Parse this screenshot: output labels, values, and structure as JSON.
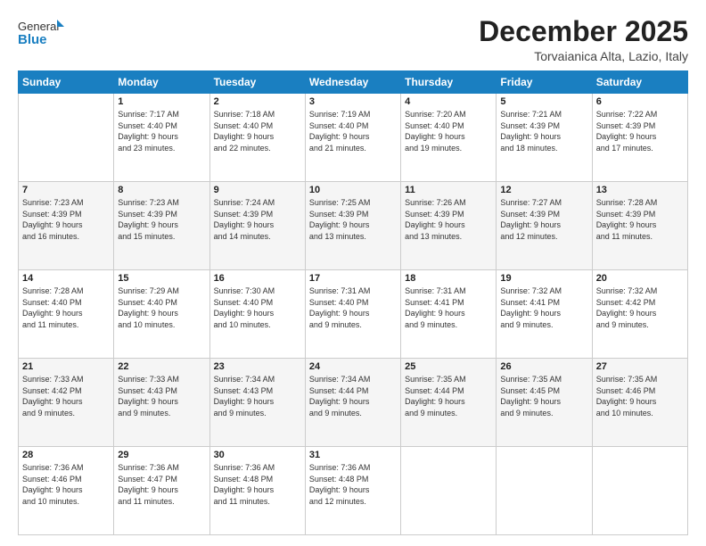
{
  "logo": {
    "general": "General",
    "blue": "Blue"
  },
  "header": {
    "title": "December 2025",
    "subtitle": "Torvaianica Alta, Lazio, Italy"
  },
  "weekdays": [
    "Sunday",
    "Monday",
    "Tuesday",
    "Wednesday",
    "Thursday",
    "Friday",
    "Saturday"
  ],
  "weeks": [
    [
      {
        "day": "",
        "info": ""
      },
      {
        "day": "1",
        "info": "Sunrise: 7:17 AM\nSunset: 4:40 PM\nDaylight: 9 hours\nand 23 minutes."
      },
      {
        "day": "2",
        "info": "Sunrise: 7:18 AM\nSunset: 4:40 PM\nDaylight: 9 hours\nand 22 minutes."
      },
      {
        "day": "3",
        "info": "Sunrise: 7:19 AM\nSunset: 4:40 PM\nDaylight: 9 hours\nand 21 minutes."
      },
      {
        "day": "4",
        "info": "Sunrise: 7:20 AM\nSunset: 4:40 PM\nDaylight: 9 hours\nand 19 minutes."
      },
      {
        "day": "5",
        "info": "Sunrise: 7:21 AM\nSunset: 4:39 PM\nDaylight: 9 hours\nand 18 minutes."
      },
      {
        "day": "6",
        "info": "Sunrise: 7:22 AM\nSunset: 4:39 PM\nDaylight: 9 hours\nand 17 minutes."
      }
    ],
    [
      {
        "day": "7",
        "info": "Sunrise: 7:23 AM\nSunset: 4:39 PM\nDaylight: 9 hours\nand 16 minutes."
      },
      {
        "day": "8",
        "info": "Sunrise: 7:23 AM\nSunset: 4:39 PM\nDaylight: 9 hours\nand 15 minutes."
      },
      {
        "day": "9",
        "info": "Sunrise: 7:24 AM\nSunset: 4:39 PM\nDaylight: 9 hours\nand 14 minutes."
      },
      {
        "day": "10",
        "info": "Sunrise: 7:25 AM\nSunset: 4:39 PM\nDaylight: 9 hours\nand 13 minutes."
      },
      {
        "day": "11",
        "info": "Sunrise: 7:26 AM\nSunset: 4:39 PM\nDaylight: 9 hours\nand 13 minutes."
      },
      {
        "day": "12",
        "info": "Sunrise: 7:27 AM\nSunset: 4:39 PM\nDaylight: 9 hours\nand 12 minutes."
      },
      {
        "day": "13",
        "info": "Sunrise: 7:28 AM\nSunset: 4:39 PM\nDaylight: 9 hours\nand 11 minutes."
      }
    ],
    [
      {
        "day": "14",
        "info": "Sunrise: 7:28 AM\nSunset: 4:40 PM\nDaylight: 9 hours\nand 11 minutes."
      },
      {
        "day": "15",
        "info": "Sunrise: 7:29 AM\nSunset: 4:40 PM\nDaylight: 9 hours\nand 10 minutes."
      },
      {
        "day": "16",
        "info": "Sunrise: 7:30 AM\nSunset: 4:40 PM\nDaylight: 9 hours\nand 10 minutes."
      },
      {
        "day": "17",
        "info": "Sunrise: 7:31 AM\nSunset: 4:40 PM\nDaylight: 9 hours\nand 9 minutes."
      },
      {
        "day": "18",
        "info": "Sunrise: 7:31 AM\nSunset: 4:41 PM\nDaylight: 9 hours\nand 9 minutes."
      },
      {
        "day": "19",
        "info": "Sunrise: 7:32 AM\nSunset: 4:41 PM\nDaylight: 9 hours\nand 9 minutes."
      },
      {
        "day": "20",
        "info": "Sunrise: 7:32 AM\nSunset: 4:42 PM\nDaylight: 9 hours\nand 9 minutes."
      }
    ],
    [
      {
        "day": "21",
        "info": "Sunrise: 7:33 AM\nSunset: 4:42 PM\nDaylight: 9 hours\nand 9 minutes."
      },
      {
        "day": "22",
        "info": "Sunrise: 7:33 AM\nSunset: 4:43 PM\nDaylight: 9 hours\nand 9 minutes."
      },
      {
        "day": "23",
        "info": "Sunrise: 7:34 AM\nSunset: 4:43 PM\nDaylight: 9 hours\nand 9 minutes."
      },
      {
        "day": "24",
        "info": "Sunrise: 7:34 AM\nSunset: 4:44 PM\nDaylight: 9 hours\nand 9 minutes."
      },
      {
        "day": "25",
        "info": "Sunrise: 7:35 AM\nSunset: 4:44 PM\nDaylight: 9 hours\nand 9 minutes."
      },
      {
        "day": "26",
        "info": "Sunrise: 7:35 AM\nSunset: 4:45 PM\nDaylight: 9 hours\nand 9 minutes."
      },
      {
        "day": "27",
        "info": "Sunrise: 7:35 AM\nSunset: 4:46 PM\nDaylight: 9 hours\nand 10 minutes."
      }
    ],
    [
      {
        "day": "28",
        "info": "Sunrise: 7:36 AM\nSunset: 4:46 PM\nDaylight: 9 hours\nand 10 minutes."
      },
      {
        "day": "29",
        "info": "Sunrise: 7:36 AM\nSunset: 4:47 PM\nDaylight: 9 hours\nand 11 minutes."
      },
      {
        "day": "30",
        "info": "Sunrise: 7:36 AM\nSunset: 4:48 PM\nDaylight: 9 hours\nand 11 minutes."
      },
      {
        "day": "31",
        "info": "Sunrise: 7:36 AM\nSunset: 4:48 PM\nDaylight: 9 hours\nand 12 minutes."
      },
      {
        "day": "",
        "info": ""
      },
      {
        "day": "",
        "info": ""
      },
      {
        "day": "",
        "info": ""
      }
    ]
  ]
}
